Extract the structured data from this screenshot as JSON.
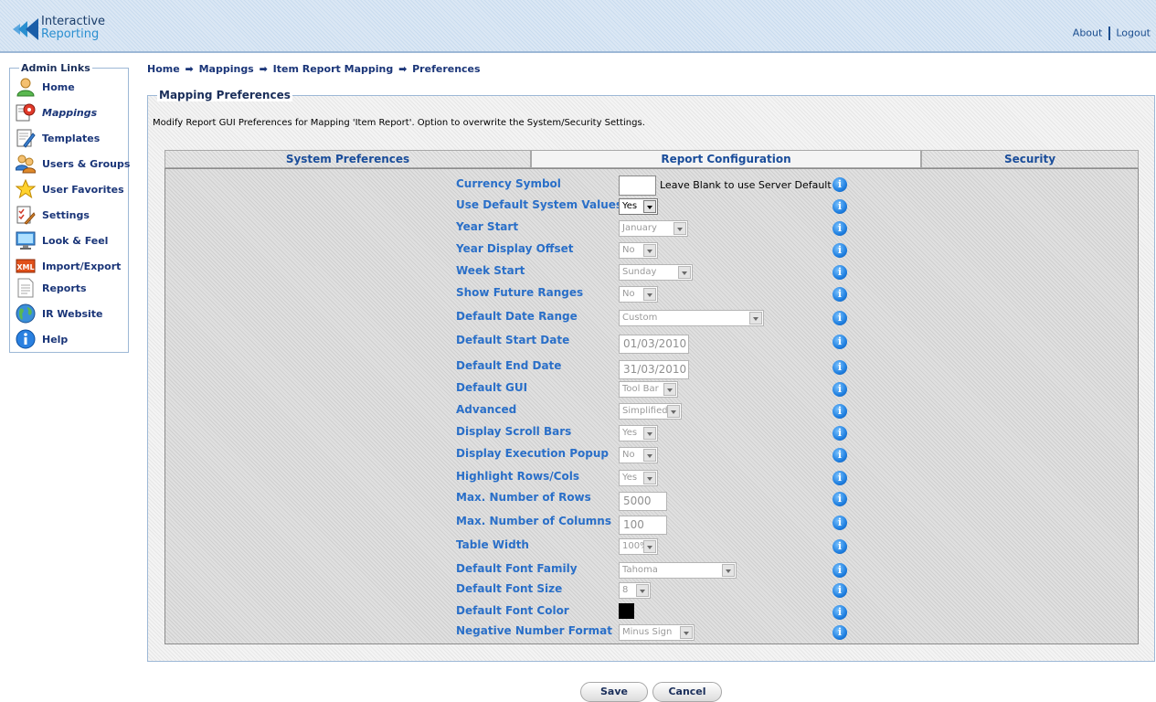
{
  "header": {
    "logo_line1": "Interactive",
    "logo_line2": "Reporting",
    "about_label": "About",
    "logout_label": "Logout"
  },
  "sidebar": {
    "title": "Admin Links",
    "items": [
      {
        "label": "Home",
        "icon": "user-icon"
      },
      {
        "label": "Mappings",
        "icon": "mappings-icon"
      },
      {
        "label": "Templates",
        "icon": "templates-icon"
      },
      {
        "label": "Users & Groups",
        "icon": "users-groups-icon"
      },
      {
        "label": "User Favorites",
        "icon": "star-icon"
      },
      {
        "label": "Settings",
        "icon": "settings-icon"
      },
      {
        "label": "Look & Feel",
        "icon": "monitor-icon"
      },
      {
        "label": "Import/Export",
        "icon": "xml-icon"
      },
      {
        "label": "Reports",
        "icon": "report-document-icon"
      },
      {
        "label": "IR Website",
        "icon": "globe-icon"
      },
      {
        "label": "Help",
        "icon": "help-icon"
      }
    ]
  },
  "breadcrumb": {
    "home": "Home",
    "mappings": "Mappings",
    "item_report_mapping": "Item Report Mapping",
    "current": "Preferences",
    "arrow": "➡"
  },
  "main": {
    "title": "Mapping Preferences",
    "description": "Modify Report GUI Preferences for Mapping 'Item Report'. Option to overwrite the System/Security Settings.",
    "tabs": [
      {
        "label": "System Preferences"
      },
      {
        "label": "Report Configuration"
      },
      {
        "label": "Security"
      }
    ],
    "info_glyph": "i",
    "fields": {
      "currency_symbol": {
        "label": "Currency Symbol",
        "value": "",
        "hint": "Leave Blank to use Server Default"
      },
      "use_default_system_values": {
        "label": "Use Default System Values",
        "value": "Yes"
      },
      "year_start": {
        "label": "Year Start",
        "value": "January"
      },
      "year_display_offset": {
        "label": "Year Display Offset",
        "value": "No"
      },
      "week_start": {
        "label": "Week Start",
        "value": "Sunday"
      },
      "show_future_ranges": {
        "label": "Show Future Ranges",
        "value": "No"
      },
      "default_date_range": {
        "label": "Default Date Range",
        "value": "Custom"
      },
      "default_start_date": {
        "label": "Default Start Date",
        "value": "01/03/2010"
      },
      "default_end_date": {
        "label": "Default End Date",
        "value": "31/03/2010"
      },
      "default_gui": {
        "label": "Default GUI",
        "value": "Tool Bar"
      },
      "advanced": {
        "label": "Advanced",
        "value": "Simplified"
      },
      "display_scroll_bars": {
        "label": "Display Scroll Bars",
        "value": "Yes"
      },
      "display_execution_popup": {
        "label": "Display Execution Popup",
        "value": "No"
      },
      "highlight_rows_cols": {
        "label": "Highlight Rows/Cols",
        "value": "Yes"
      },
      "max_number_of_rows": {
        "label": "Max. Number of Rows",
        "value": "5000"
      },
      "max_number_of_columns": {
        "label": "Max. Number of Columns",
        "value": "100"
      },
      "table_width": {
        "label": "Table Width",
        "value": "100%"
      },
      "default_font_family": {
        "label": "Default Font Family",
        "value": "Tahoma"
      },
      "default_font_size": {
        "label": "Default Font Size",
        "value": "8"
      },
      "default_font_color": {
        "label": "Default Font Color",
        "value": "#000000"
      },
      "negative_number_format": {
        "label": "Negative Number Format",
        "value": "Minus Sign"
      }
    }
  },
  "buttons": {
    "save": "Save",
    "cancel": "Cancel"
  }
}
